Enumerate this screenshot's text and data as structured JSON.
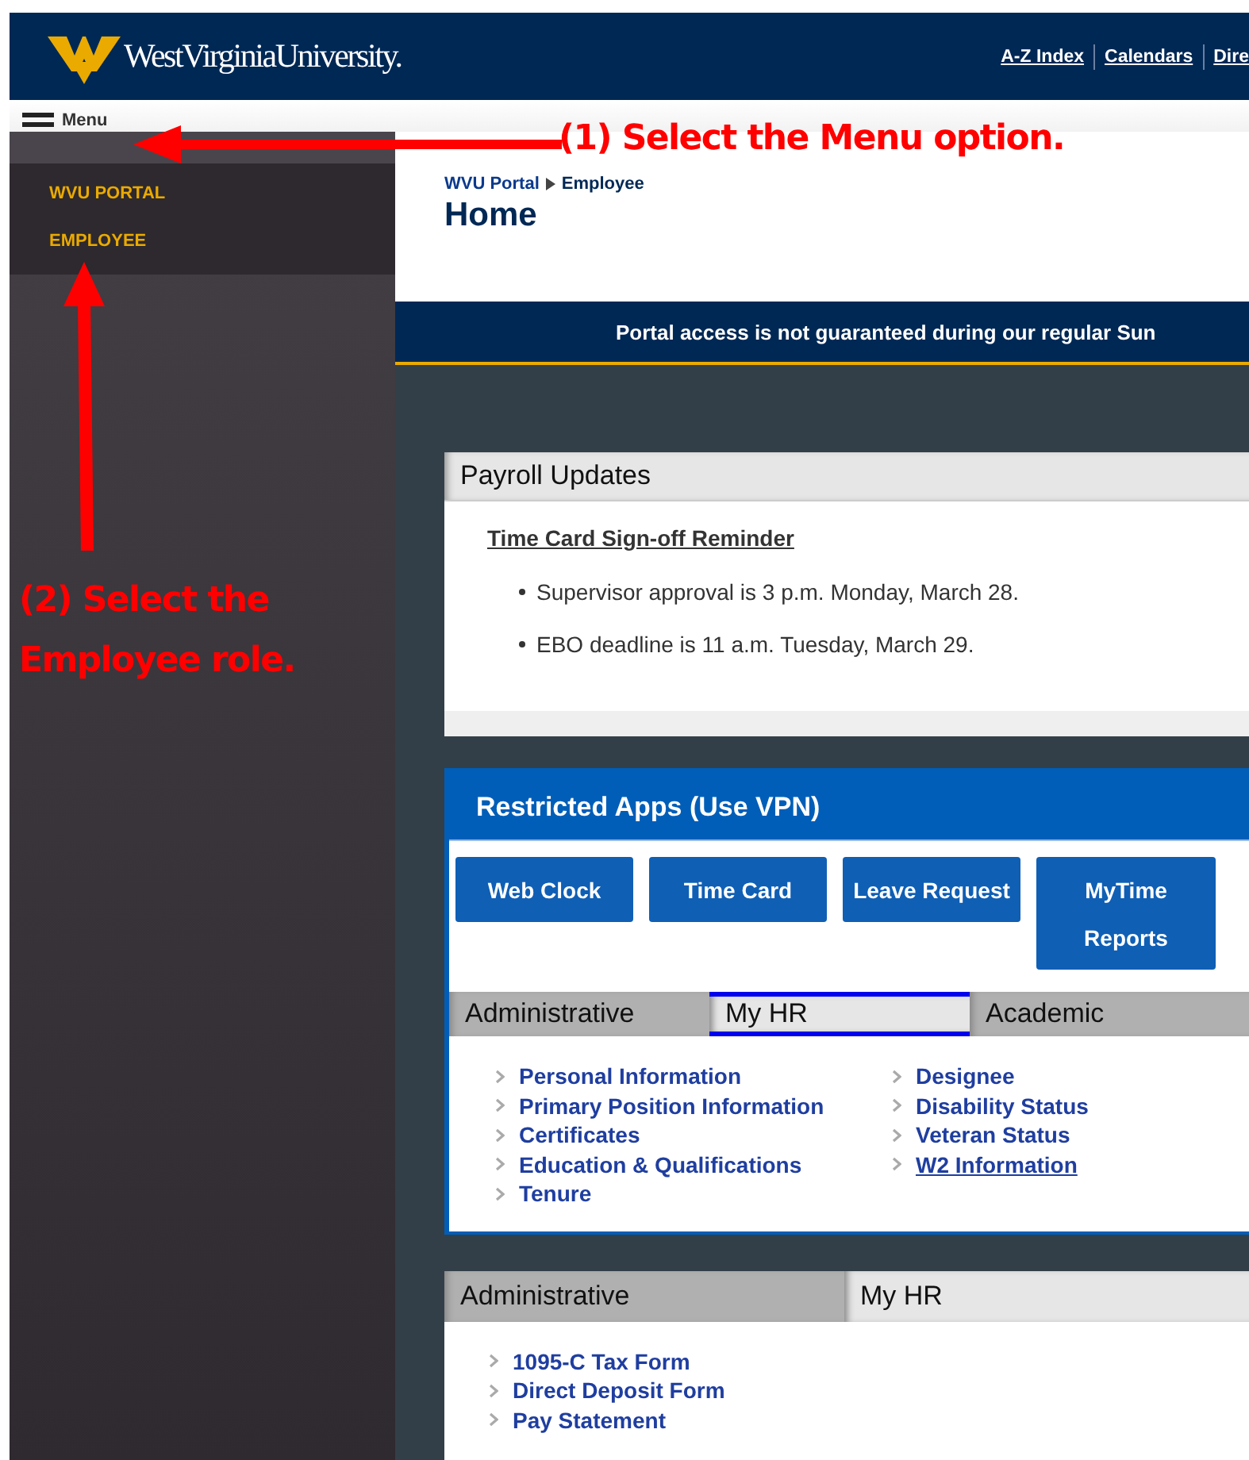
{
  "header": {
    "logo_text": "WestVirginiaUniversity.",
    "links": [
      "A-Z Index",
      "Calendars",
      "Dire"
    ]
  },
  "menu_button": {
    "label": "Menu"
  },
  "sidebar": {
    "items": [
      "WVU PORTAL",
      "EMPLOYEE"
    ]
  },
  "breadcrumb": [
    "WVU Portal",
    "Employee"
  ],
  "page_title": "Home",
  "notice": "Portal access is not guaranteed during our regular Sun",
  "payroll": {
    "title": "Payroll Updates",
    "heading": "Time Card Sign-off Reminder",
    "bullets": [
      "Supervisor approval is 3 p.m. Monday, March 28.",
      "EBO deadline is 11 a.m. Tuesday, March 29."
    ]
  },
  "restricted_apps": {
    "title": "Restricted Apps (Use VPN)",
    "buttons": [
      "Web Clock",
      "Time Card",
      "Leave Request",
      "MyTime Reports"
    ],
    "tabs": [
      {
        "label": "Administrative",
        "selected": false,
        "focused": false
      },
      {
        "label": "My HR",
        "selected": true,
        "focused": true
      },
      {
        "label": "Academic",
        "selected": false,
        "focused": false
      }
    ],
    "columns": [
      [
        {
          "label": "Personal Information",
          "underlined": false
        },
        {
          "label": "Primary Position Information",
          "underlined": false
        },
        {
          "label": "Certificates",
          "underlined": false
        },
        {
          "label": "Education & Qualifications",
          "underlined": false
        },
        {
          "label": "Tenure",
          "underlined": false
        }
      ],
      [
        {
          "label": "Designee",
          "underlined": false
        },
        {
          "label": "Disability Status",
          "underlined": false
        },
        {
          "label": "Veteran Status",
          "underlined": false
        },
        {
          "label": "W2 Information",
          "underlined": true
        }
      ]
    ]
  },
  "lower_panel": {
    "tabs": [
      {
        "label": "Administrative",
        "selected": false,
        "focused": false
      },
      {
        "label": "My HR",
        "selected": true,
        "focused": false
      }
    ],
    "links": [
      {
        "label": "1095-C Tax Form",
        "underlined": false
      },
      {
        "label": "Direct Deposit Form",
        "underlined": false
      },
      {
        "label": "Pay Statement",
        "underlined": false
      }
    ]
  },
  "annotations": [
    {
      "kind": "arrow-left",
      "text": "(1) Select the Menu option."
    },
    {
      "kind": "arrow-up",
      "text": "(2) Select the Employee role."
    }
  ]
}
